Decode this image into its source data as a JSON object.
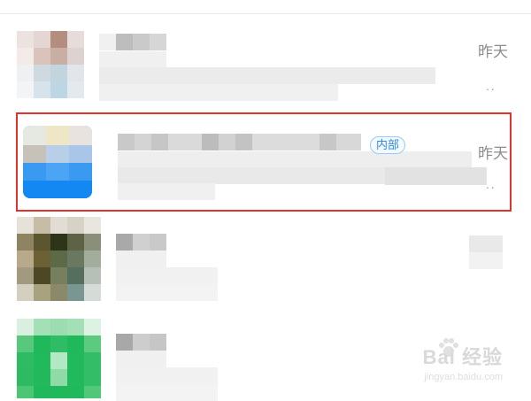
{
  "conversations": [
    {
      "time": "昨天",
      "tag": "",
      "more": "··"
    },
    {
      "time": "昨天",
      "tag": "内部",
      "more": "··"
    },
    {
      "time": "",
      "tag": "",
      "more": ""
    },
    {
      "time": "",
      "tag": "",
      "more": ""
    }
  ],
  "watermark": {
    "brand": "Bai 经验",
    "url": "jingyan.baidu.com"
  },
  "colors": {
    "highlight_frame": "#e0332d",
    "tag_text": "#2b8af0"
  },
  "icons": [
    "paw-icon"
  ]
}
